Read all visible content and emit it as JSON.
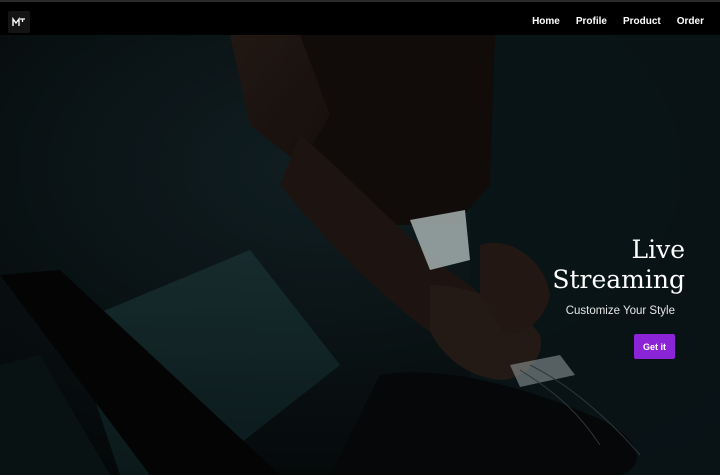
{
  "nav": {
    "logo_icon": "brand-logo-icon",
    "items": [
      {
        "label": "Home"
      },
      {
        "label": "Profile"
      },
      {
        "label": "Product"
      },
      {
        "label": "Order"
      }
    ]
  },
  "hero": {
    "title_line1": "Live",
    "title_line2": "Streaming",
    "subtitle": "Customize Your Style",
    "cta_label": "Get it",
    "cta_color": "#8a24d6"
  }
}
